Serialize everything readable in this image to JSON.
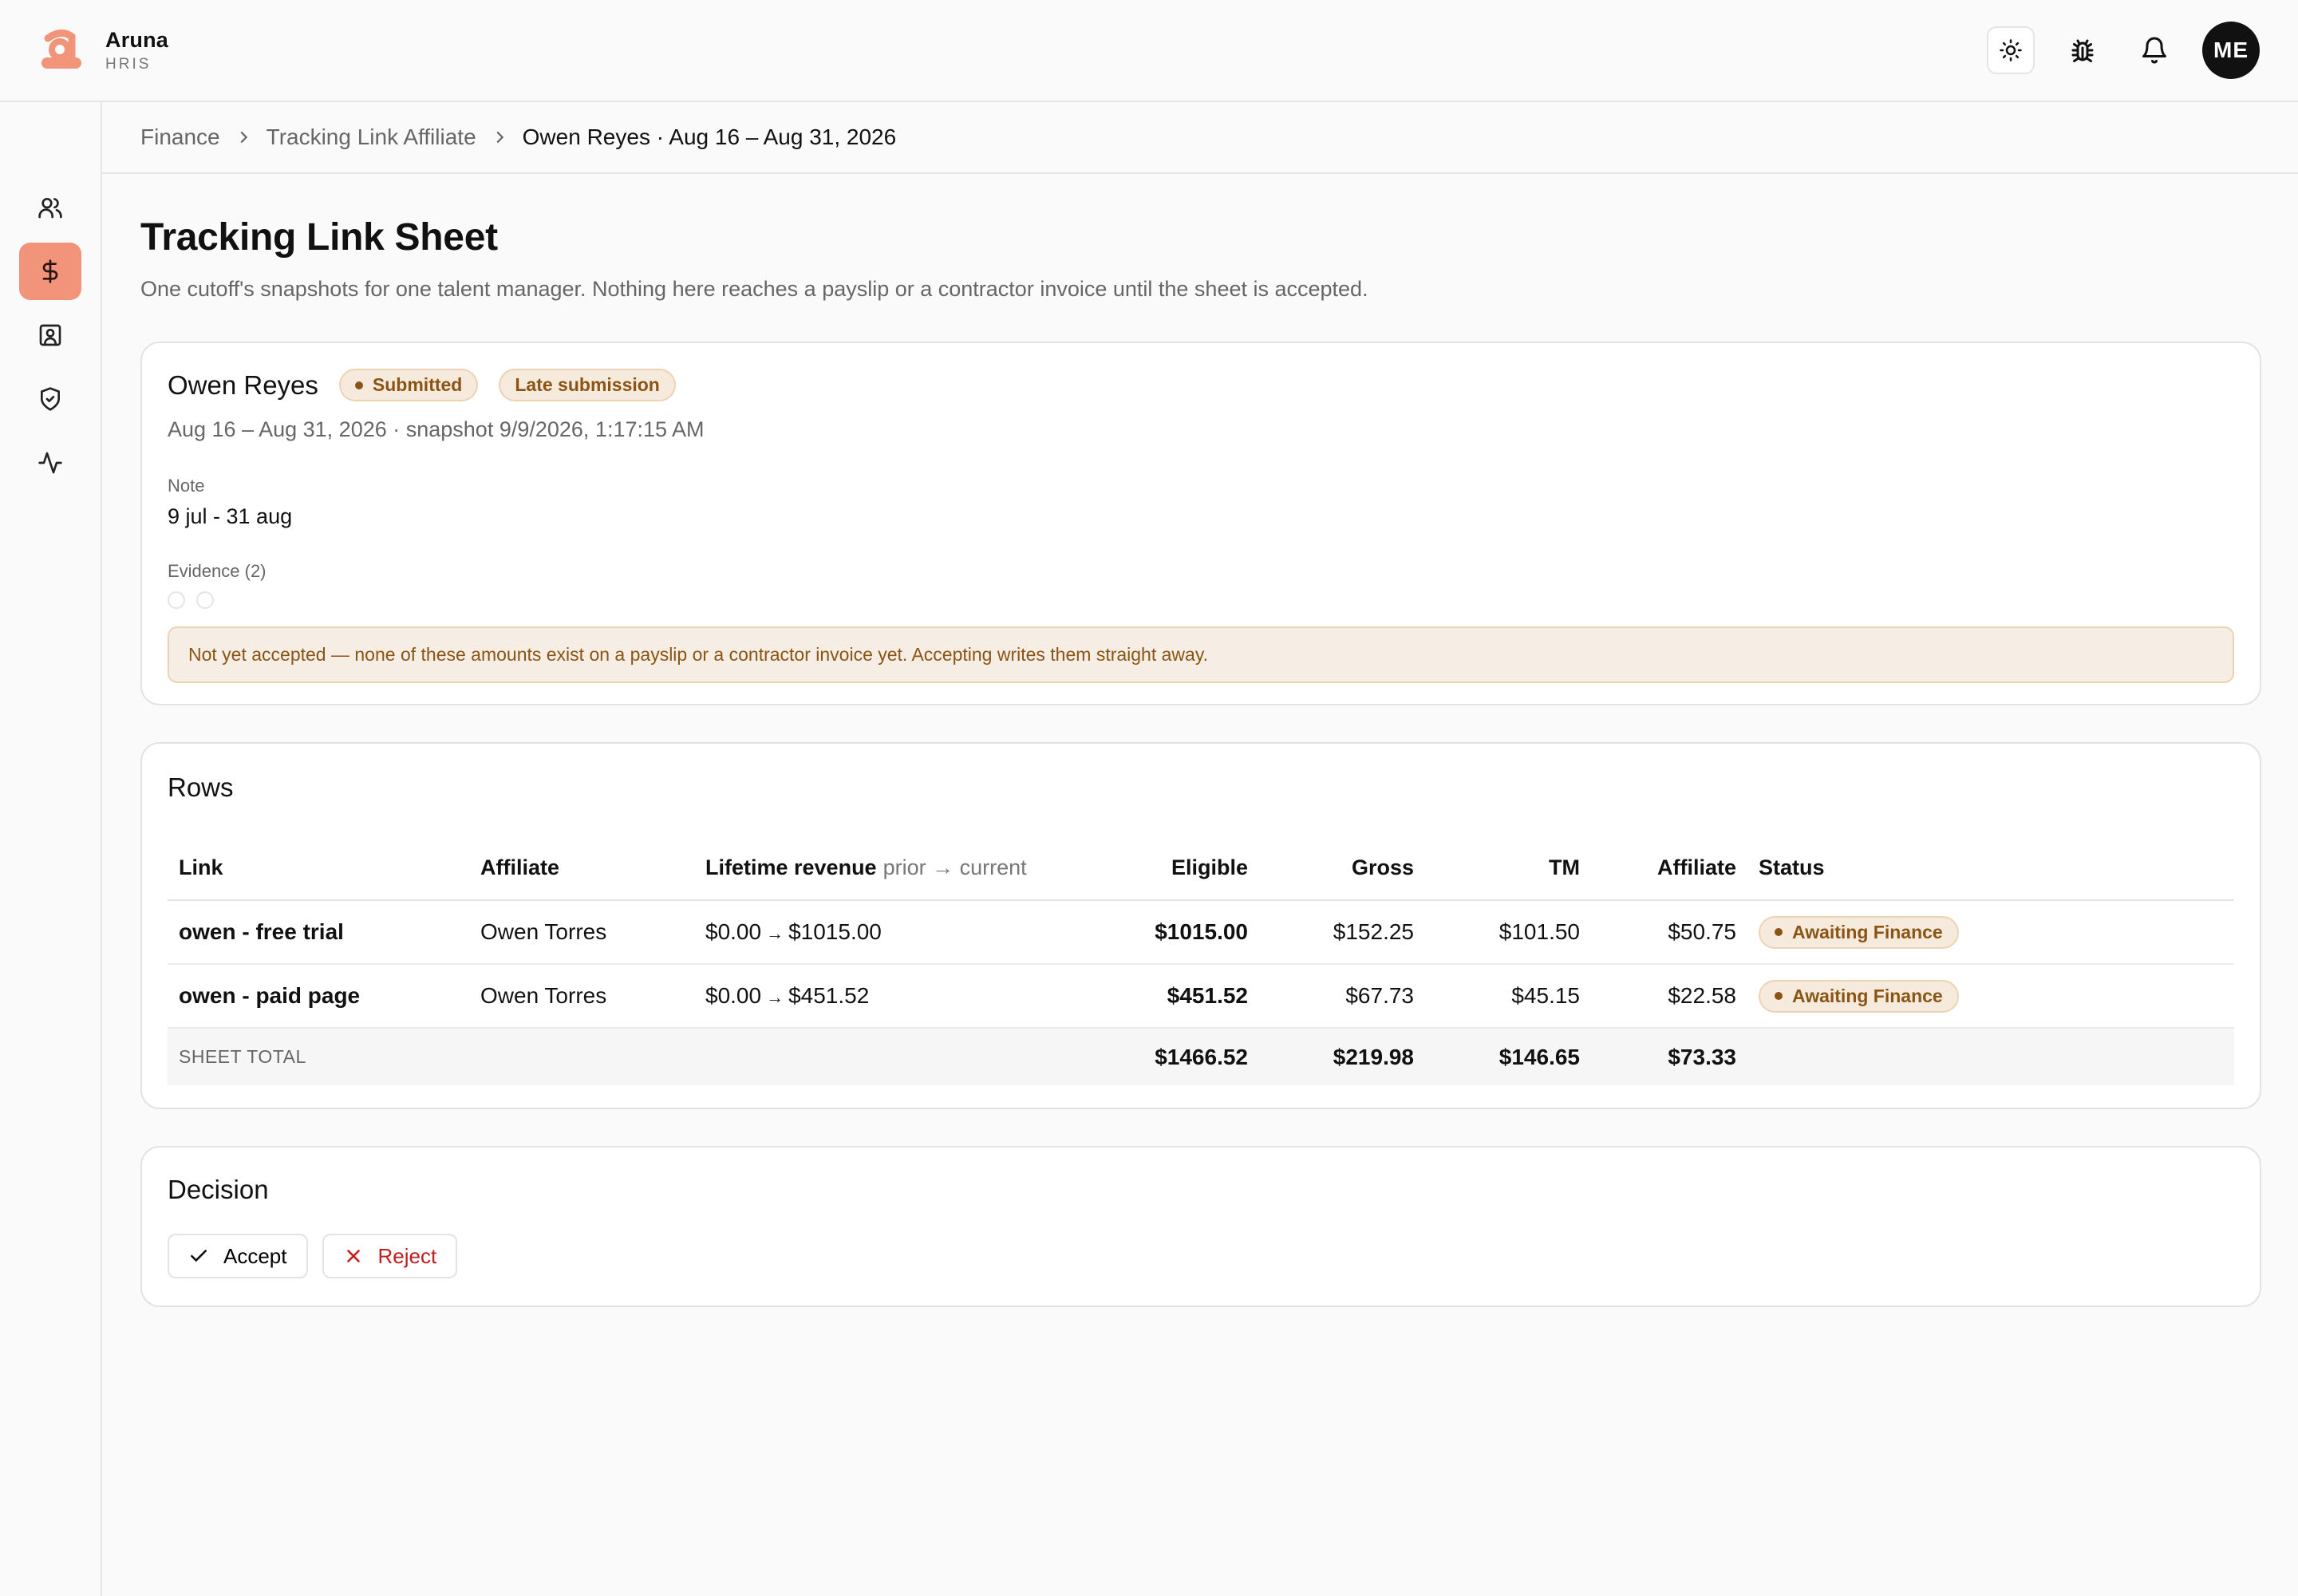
{
  "brand": {
    "name": "Aruna",
    "sub": "HRIS"
  },
  "header": {
    "avatar_initials": "ME",
    "icons": [
      "sun-icon",
      "bug-icon",
      "bell-icon"
    ]
  },
  "sidebar": {
    "items": [
      {
        "icon": "users-icon"
      },
      {
        "icon": "dollar-icon",
        "active": true
      },
      {
        "icon": "contact-card-icon"
      },
      {
        "icon": "shield-check-icon"
      },
      {
        "icon": "activity-icon"
      }
    ]
  },
  "breadcrumb": [
    "Finance",
    "Tracking Link Affiliate",
    "Owen Reyes · Aug 16 – Aug 31, 2026"
  ],
  "page": {
    "title": "Tracking Link Sheet",
    "subtitle": "One cutoff's snapshots for one talent manager. Nothing here reaches a payslip or a contractor invoice until the sheet is accepted."
  },
  "sheet": {
    "person": "Owen Reyes",
    "badges": {
      "status": "Submitted",
      "late": "Late submission"
    },
    "period": "Aug 16 – Aug 31, 2026 · snapshot 9/9/2026, 1:17:15 AM",
    "note_label": "Note",
    "note_value": "9 jul - 31 aug",
    "evidence_label": "Evidence (2)",
    "notice": "Not yet accepted — none of these amounts exist on a payslip or a contractor invoice yet. Accepting writes them straight away."
  },
  "rows_section": {
    "title": "Rows",
    "columns": {
      "link": "Link",
      "affiliate": "Affiliate",
      "lifetime": "Lifetime revenue",
      "lifetime_hint": "prior → current",
      "eligible": "Eligible",
      "gross": "Gross",
      "tm": "TM",
      "affiliate_amt": "Affiliate",
      "status": "Status"
    },
    "rows": [
      {
        "link": "owen - free trial",
        "affiliate": "Owen Torres",
        "prior": "$0.00",
        "current": "$1015.00",
        "eligible": "$1015.00",
        "gross": "$152.25",
        "tm": "$101.50",
        "affiliate_amt": "$50.75",
        "status": "Awaiting Finance"
      },
      {
        "link": "owen - paid page",
        "affiliate": "Owen Torres",
        "prior": "$0.00",
        "current": "$451.52",
        "eligible": "$451.52",
        "gross": "$67.73",
        "tm": "$45.15",
        "affiliate_amt": "$22.58",
        "status": "Awaiting Finance"
      }
    ],
    "total": {
      "label": "SHEET TOTAL",
      "eligible": "$1466.52",
      "gross": "$219.98",
      "tm": "$146.65",
      "affiliate_amt": "$73.33"
    },
    "arrow": "→"
  },
  "decision": {
    "title": "Decision",
    "accept": "Accept",
    "reject": "Reject"
  }
}
